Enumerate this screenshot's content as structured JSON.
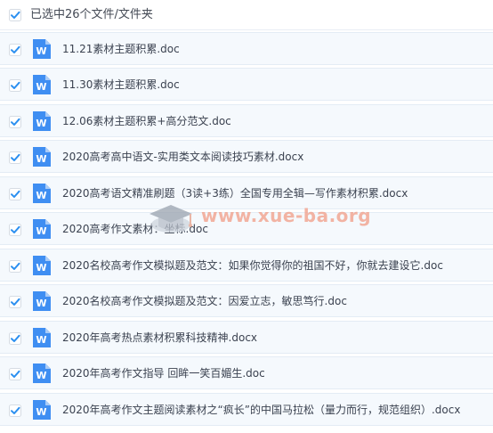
{
  "header": {
    "text": "已选中26个文件/文件夹",
    "checked": true
  },
  "files": [
    {
      "name": "11.21素材主题积累.doc",
      "icon": "word-doc-icon",
      "checked": true
    },
    {
      "name": "11.30素材主题积累.doc",
      "icon": "word-doc-icon",
      "checked": true
    },
    {
      "name": "12.06素材主题积累+高分范文.doc",
      "icon": "word-doc-icon",
      "checked": true
    },
    {
      "name": "2020高考高中语文-实用类文本阅读技巧素材.docx",
      "icon": "word-doc-icon",
      "checked": true
    },
    {
      "name": "2020高考语文精准刷题（3读+3练）全国专用全辑—写作素材积累.docx",
      "icon": "word-doc-icon",
      "checked": true
    },
    {
      "name": "2020高考作文素材：坐标.doc",
      "icon": "word-doc-icon",
      "checked": true
    },
    {
      "name": "2020名校高考作文模拟题及范文：如果你觉得你的祖国不好，你就去建设它.doc",
      "icon": "word-doc-icon",
      "checked": true
    },
    {
      "name": "2020名校高考作文模拟题及范文：因爱立志，敏思笃行.doc",
      "icon": "word-doc-icon",
      "checked": true
    },
    {
      "name": "2020年高考热点素材积累科技精神.docx",
      "icon": "word-doc-icon",
      "checked": true
    },
    {
      "name": "2020年高考作文指导 回眸一笑百媚生.doc",
      "icon": "word-doc-icon",
      "checked": true
    },
    {
      "name": "2020年高考作文主题阅读素材之“疯长”的中国马拉松（量力而行，规范组织）.docx",
      "icon": "word-doc-icon",
      "checked": true
    }
  ],
  "watermark": {
    "text": "www.xue-ba.org"
  },
  "colors": {
    "accent": "#2b8ff0",
    "icon_blue": "#3f8ef2",
    "row_bg": "#f5f9fd",
    "row_border": "#e4ecf5",
    "text": "#3b4250",
    "watermark": "#f2a28d"
  }
}
